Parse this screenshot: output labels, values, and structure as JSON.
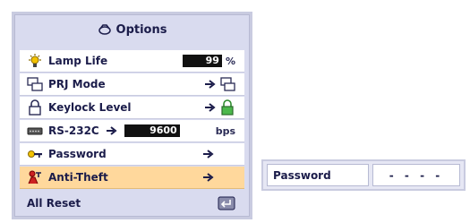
{
  "menu": {
    "title": "Options",
    "items": [
      {
        "label": "Lamp Life",
        "value": "99",
        "unit": "%",
        "icon": "lamp-icon"
      },
      {
        "label": "PRJ Mode",
        "icon": "projector-mode-icon"
      },
      {
        "label": "Keylock Level",
        "icon": "lock-icon"
      },
      {
        "label": "RS-232C",
        "value": "9600",
        "unit": "bps",
        "icon": "serial-port-icon"
      },
      {
        "label": "Password",
        "icon": "key-icon"
      },
      {
        "label": "Anti-Theft",
        "icon": "anti-theft-icon",
        "selected": true
      }
    ],
    "reset": {
      "label": "All Reset",
      "icon": "enter-icon"
    }
  },
  "submenu": {
    "label": "Password",
    "value": "- - - -"
  },
  "colors": {
    "panel": "#d9dbef",
    "selected": "#ffd89c",
    "text": "#1b1c4a"
  }
}
